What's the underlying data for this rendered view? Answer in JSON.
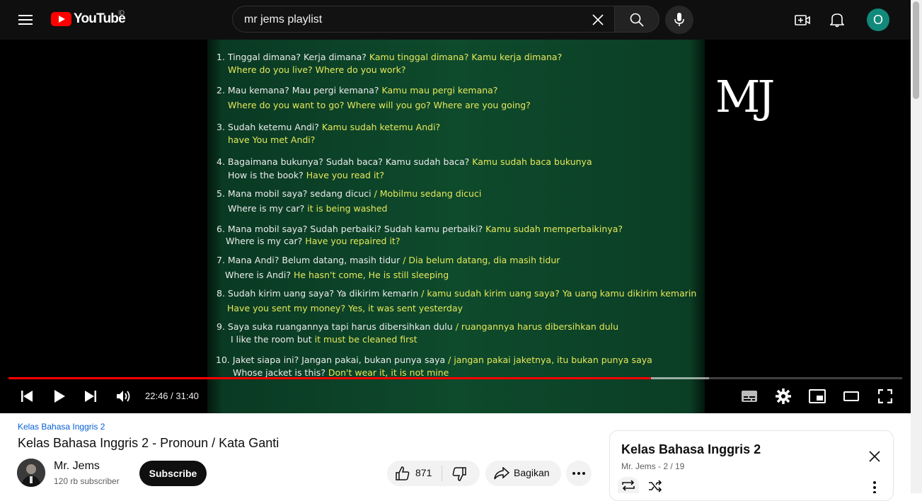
{
  "header": {
    "logo_text": "YouTube",
    "country_code": "ID",
    "search_value": "mr jems playlist",
    "avatar_letter": "O"
  },
  "video": {
    "lines": [
      [
        {
          "t": "1. Tinggal dimana? Kerja dimana?",
          "c": "w"
        },
        {
          "t": "  Kamu tinggal dimana? Kamu kerja dimana?",
          "c": "y"
        }
      ],
      [
        {
          "t": "Where  do   you live?   Where do  you work?",
          "c": "y"
        }
      ],
      [
        {
          "t": "2. Mau kemana?  Mau pergi kemana?",
          "c": "w"
        },
        {
          "t": "      Kamu mau pergi kemana?",
          "c": "y"
        }
      ],
      [
        {
          "t": "Where do  you  want to  go?  Where  will  you  go?   Where  are  you  going?",
          "c": "y"
        }
      ],
      [
        {
          "t": "3. Sudah ketemu Andi?",
          "c": "w"
        },
        {
          "t": "  Kamu sudah ketemu Andi?",
          "c": "y"
        }
      ],
      [
        {
          "t": "have  You    met Andi?",
          "c": "y"
        }
      ],
      [
        {
          "t": "4. Bagaimana bukunya? Sudah baca? Kamu sudah baca?",
          "c": "w"
        },
        {
          "t": " Kamu sudah baca bukunya",
          "c": "y"
        }
      ],
      [
        {
          "t": "How  is  the book?",
          "c": "w"
        },
        {
          "t": "  Have you read  it?",
          "c": "y"
        }
      ],
      [
        {
          "t": "5. Mana mobil saya? sedang dicuci",
          "c": "w"
        },
        {
          "t": " /  Mobilmu sedang dicuci",
          "c": "y"
        }
      ],
      [
        {
          "t": "Where  is   my car?",
          "c": "w"
        },
        {
          "t": "  it   is   being washed",
          "c": "y"
        }
      ],
      [
        {
          "t": "6. Mana mobil saya? Sudah perbaiki? Sudah kamu perbaiki?",
          "c": "w"
        },
        {
          "t": "  Kamu sudah memperbaikinya?",
          "c": "y"
        }
      ],
      [
        {
          "t": "Where   is my car?",
          "c": "w"
        },
        {
          "t": "  Have  you repaired  it?",
          "c": "y"
        }
      ],
      [
        {
          "t": "7. Mana Andi? Belum datang, masih tidur",
          "c": "w"
        },
        {
          "t": "   /  Dia belum datang, dia masih tidur",
          "c": "y"
        }
      ],
      [
        {
          "t": "Where   is   Andi?",
          "c": "w"
        },
        {
          "t": "  He  hasn't  come,  He  is  still  sleeping",
          "c": "y"
        }
      ],
      [
        {
          "t": "8. Sudah kirim uang saya? Ya dikirim kemarin",
          "c": "w"
        },
        {
          "t": "  /  kamu sudah kirim uang saya? Ya uang kamu dikirim kemarin",
          "c": "y"
        }
      ],
      [
        {
          "t": "Have  you  sent   my money? Yes,  it  was   sent   yesterday",
          "c": "y"
        }
      ],
      [
        {
          "t": "9. Saya suka ruangannya tapi harus dibersihkan dulu",
          "c": "w"
        },
        {
          "t": "     /  ruangannya harus dibersihkan dulu",
          "c": "y"
        }
      ],
      [
        {
          "t": "I   like   the room but",
          "c": "w"
        },
        {
          "t": " it must  be   cleaned   first",
          "c": "y"
        }
      ],
      [
        {
          "t": "10. Jaket siapa ini? Jangan pakai, bukan punya saya",
          "c": "w"
        },
        {
          "t": "   /  jangan pakai jaketnya, itu bukan punya saya",
          "c": "y"
        }
      ],
      [
        {
          "t": "Whose jacket is  this?",
          "c": "w"
        },
        {
          "t": "  Don't  wear  it,  it  is not  mine",
          "c": "y"
        }
      ]
    ],
    "watermark": "MJ",
    "progress_fraction": 0.719,
    "buffer_fraction": 0.784,
    "time": "22:46 / 31:40"
  },
  "info": {
    "playlist_link": "Kelas Bahasa Inggris 2",
    "title": "Kelas Bahasa Inggris 2 - Pronoun / Kata Ganti",
    "channel_name": "Mr. Jems",
    "subscriber_count": "120 rb subscriber",
    "subscribe_label": "Subscribe",
    "like_count": "871",
    "share_label": "Bagikan"
  },
  "playlist_panel": {
    "title": "Kelas Bahasa Inggris 2",
    "subtitle": "Mr. Jems - 2 / 19"
  }
}
